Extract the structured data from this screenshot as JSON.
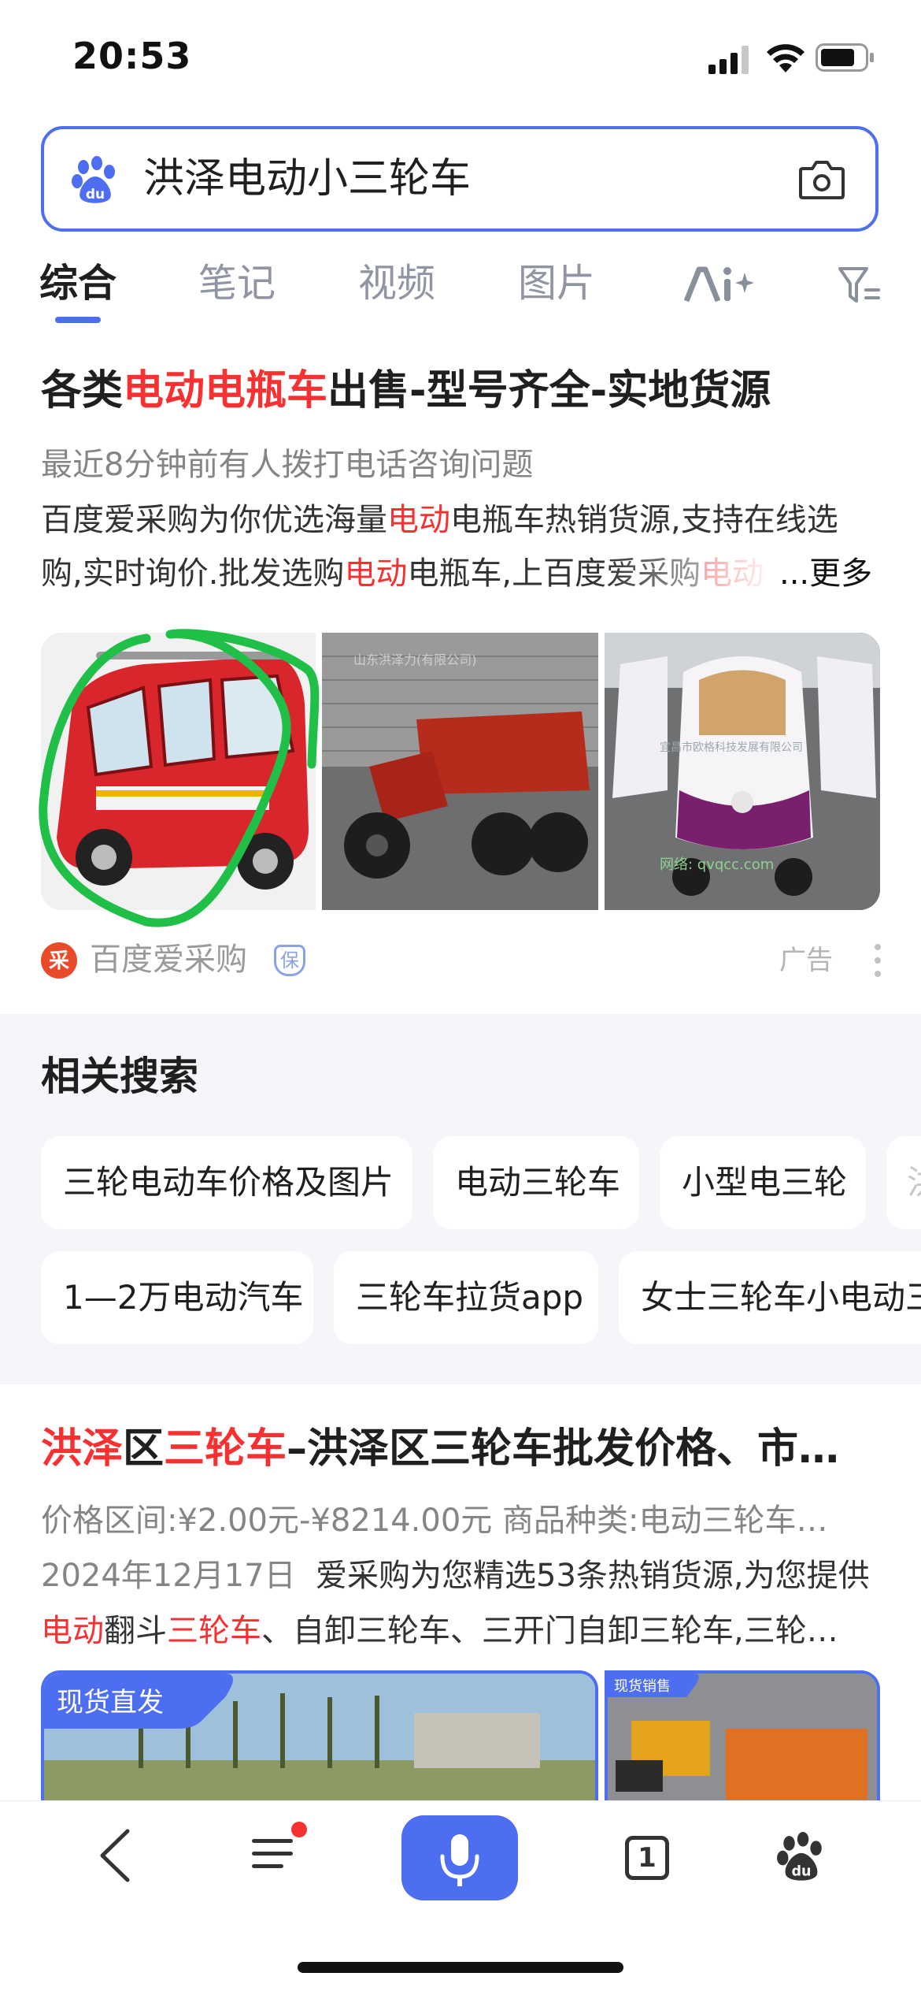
{
  "status_bar": {
    "time": "20:53"
  },
  "search": {
    "query": "洪泽电动小三轮车"
  },
  "tabs": [
    {
      "label": "综合",
      "active": true
    },
    {
      "label": "笔记"
    },
    {
      "label": "视频"
    },
    {
      "label": "图片"
    }
  ],
  "result1": {
    "title_parts": [
      "各类",
      "电动电瓶车",
      "出售-型号齐全-实地货源"
    ],
    "notice": "最近8分钟前有人拨打电话咨询问题",
    "desc_line1_parts": [
      "百度爱采购为你优选海量",
      "电动",
      "电瓶车热销货源,支持在线选"
    ],
    "desc_line2_parts": [
      "购,实时询价.批发选购",
      "电动",
      "电瓶车,上百度爱采购",
      "电动"
    ],
    "more_label": "...更多",
    "images": [
      {
        "alt": "红色电动三轮车"
      },
      {
        "alt": "红色货运三轮车",
        "caption": "山东洪泽力(有限公司)"
      },
      {
        "alt": "白紫色电动三轮车",
        "caption": "宜昌市欧格科技发展有限公司",
        "watermark": "网络: qvqcc.com"
      }
    ],
    "source": "百度爱采购",
    "source_badge": "保",
    "ad_label": "广告"
  },
  "related": {
    "heading": "相关搜索",
    "row1": [
      "三轮电动车价格及图片",
      "电动三轮车",
      "小型电三轮",
      "洪"
    ],
    "row2": [
      "1—2万电动汽车",
      "三轮车拉货app",
      "女士三轮车小电动三"
    ]
  },
  "result2": {
    "title_parts": [
      "洪泽",
      "区",
      "三轮车",
      "–洪泽区三轮车批发价格、市…"
    ],
    "line1": "价格区间:¥2.00元-¥8214.00元  商品种类:电动三轮车…",
    "line2_date": "2024年12月17日",
    "line2_text": "爱采购为您精选53条热销货源,为您提供",
    "line3_parts": [
      "电动",
      "翻斗",
      "三轮车",
      "、自卸三轮车、三开门自卸三轮车,三轮…"
    ],
    "img_badge1": "现货直发",
    "img_badge2": "现货销售"
  },
  "bottom_nav": {
    "tab_count": "1"
  },
  "colors": {
    "accent": "#4e6ef2",
    "highlight": "#f73131",
    "annotation": "#22c55e"
  }
}
